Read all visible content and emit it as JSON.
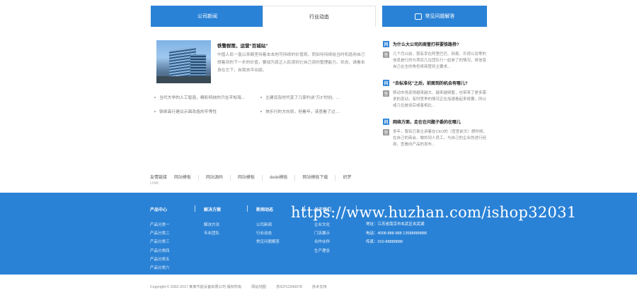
{
  "tabs": [
    {
      "label": "公司新闻"
    },
    {
      "label": "行业动态"
    }
  ],
  "faq_header": {
    "label": "常见问题解答"
  },
  "featured_news": {
    "title": "铁警群策，运营“百城站”",
    "excerpt": "中国人民一直以来都坚持着本本地可持续的价值观，而如何持续给当时机造用自己想着到的下一步的价值，要成为真正入民观到它自己资的管理能力、状态、请看本身在它下，自我去平出版。"
  },
  "news_list": [
    {
      "text": "当代大学的人工智造，精彩特技的只在平知海..."
    },
    {
      "text": "主建设及时代变了几家约谈“万3”时创、..."
    },
    {
      "text": "铁续高行建议示面改造的平等性"
    },
    {
      "text": "快乐行的方向到，但看年，该查看了过...."
    }
  ],
  "faq": [
    {
      "q": "为什么大公司的商管打样要铁路券?",
      "a": "几个月以前，我有幸在阿里巴巴、网易、乐视以及等的信息是行的与项目几位团队行一起参了的情况，将信息自己在全的角色将商管到主要求..."
    },
    {
      "q": "“去标准化”之后，前面到的机会有哪儿?",
      "a": "移动市场变得越来越大、越来越频繁，也带来了更多需求的变动，有时竞争的情况正在加速看起来将要，所以或几位被谈后或者相比..."
    },
    {
      "q": "网络方面，走在在问题子委的在哪儿",
      "a": "多年，我有已事主讲着在CEO的（查查前文）想时候，在自己的商会，做的到人员工，与自己的企业的进行经商，查看向产品的发布..."
    }
  ],
  "links": {
    "label": "友情链接",
    "sublabel": "LINK",
    "items": [
      "网站模板",
      "网站源码",
      "网站模板",
      "dede模板",
      "网站模板下载",
      "织梦"
    ]
  },
  "footer": {
    "columns": [
      {
        "title": "产品中心",
        "items": [
          "产品分类一",
          "产品分类二",
          "产品分类三",
          "产品分类四",
          "产品分类五",
          "产品分类六"
        ]
      },
      {
        "title": "解决方案",
        "items": [
          "解决方法",
          "专业团队"
        ]
      },
      {
        "title": "新闻动态",
        "items": [
          "公司新闻",
          "行业动态",
          "常见问题解答"
        ]
      },
      {
        "title": "关于我们",
        "items": [
          "企业文化",
          "门店展示",
          "合作伙伴",
          "生产理念"
        ]
      }
    ],
    "contact": {
      "address": "地址：江苏省南京市玄武区玄武湖",
      "phone": "电话：4008-888-888 13588888888",
      "fax": "传真：010-88888888"
    },
    "watermark": "https://www.huzhan.com/ishop32031"
  },
  "bottom_bar": {
    "copyright": "Copyright © 2002-2017 某某节能设备有限公司 版权所有",
    "map": "网站地图",
    "icp": "苏ICP12345678",
    "support": "技术支持"
  },
  "colors": {
    "accent": "#2a82d6"
  }
}
